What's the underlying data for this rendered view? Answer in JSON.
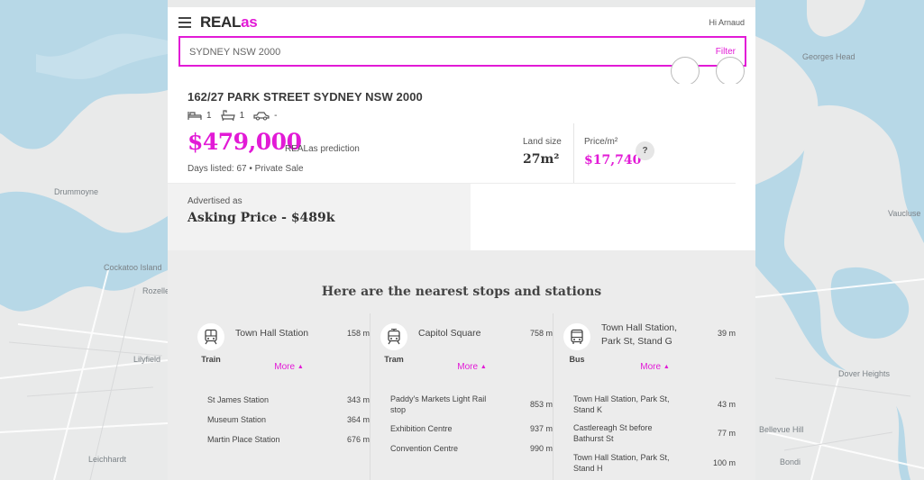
{
  "app": {
    "logo_part1": "REAL",
    "logo_part2": "as",
    "greeting": "Hi Arnaud"
  },
  "search": {
    "value": "SYDNEY NSW 2000",
    "filter_label": "Filter"
  },
  "property": {
    "address": "162/27 PARK STREET SYDNEY NSW 2000",
    "bedrooms": "1",
    "bathrooms": "1",
    "parking": "-",
    "price": "$479,000",
    "price_label": "REALas prediction",
    "listed_text": "Days listed: 67  •  Private Sale",
    "land_size_label": "Land size",
    "land_size_value": "27m²",
    "price_m2_label": "Price/m²",
    "price_m2_value": "$17,740",
    "help_label": "?",
    "advertised_label": "Advertised as",
    "advertised_value": "Asking Price - $489k"
  },
  "stops": {
    "title": "Here are the nearest stops and stations",
    "more_label": "More",
    "columns": [
      {
        "mode": "Train",
        "icon": "train-icon",
        "main_name": "Town Hall Station",
        "main_dist": "158 m",
        "items": [
          {
            "name": "St James Station",
            "dist": "343 m"
          },
          {
            "name": "Museum Station",
            "dist": "364 m"
          },
          {
            "name": "Martin Place Station",
            "dist": "676 m"
          }
        ]
      },
      {
        "mode": "Tram",
        "icon": "tram-icon",
        "main_name": "Capitol Square",
        "main_dist": "758 m",
        "items": [
          {
            "name": "Paddy's Markets Light Rail stop",
            "dist": "853 m"
          },
          {
            "name": "Exhibition Centre",
            "dist": "937 m"
          },
          {
            "name": "Convention Centre",
            "dist": "990 m"
          }
        ]
      },
      {
        "mode": "Bus",
        "icon": "bus-icon",
        "main_name": "Town Hall Station, Park St, Stand G",
        "main_dist": "39 m",
        "items": [
          {
            "name": "Town Hall Station, Park St, Stand K",
            "dist": "43 m"
          },
          {
            "name": "Castlereagh St before Bathurst St",
            "dist": "77 m"
          },
          {
            "name": "Town Hall Station, Park St, Stand H",
            "dist": "100 m"
          }
        ]
      }
    ]
  },
  "map": {
    "labels": [
      "Drummoyne",
      "Rozelle",
      "Lilyfield",
      "Leichhardt",
      "Vaucluse",
      "Dover Heights",
      "Bondi",
      "Bellevue Hill",
      "Georges Head",
      "Cockatoo Island"
    ]
  },
  "colors": {
    "accent": "#e21ad6",
    "water": "#b7d8e7",
    "land": "#e9eaea"
  }
}
